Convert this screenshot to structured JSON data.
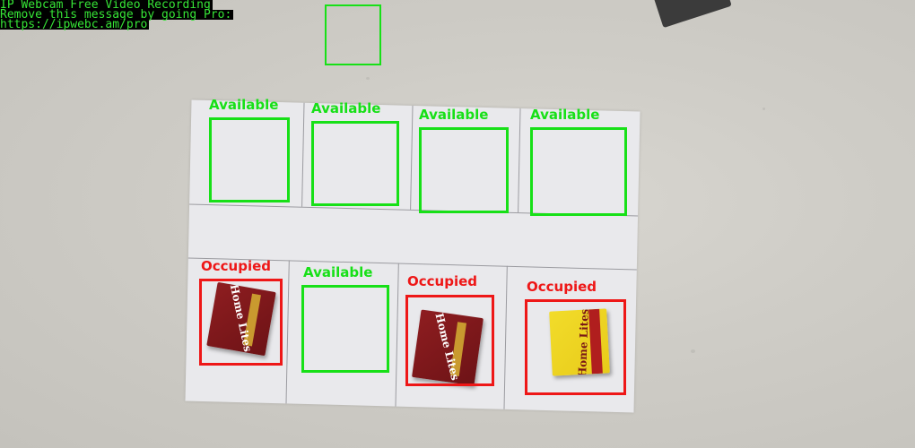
{
  "watermark": {
    "line1": "IP Webcam Free Video Recording",
    "line2": "Remove this message by going Pro:",
    "line3": "https://ipwebc.am/pro"
  },
  "slots": [
    {
      "status": "Available",
      "occupied": false
    },
    {
      "status": "Available",
      "occupied": false
    },
    {
      "status": "Available",
      "occupied": false
    },
    {
      "status": "Available",
      "occupied": false
    },
    {
      "status": "Occupied",
      "occupied": true
    },
    {
      "status": "Available",
      "occupied": false
    },
    {
      "status": "Occupied",
      "occupied": true
    },
    {
      "status": "Occupied",
      "occupied": true
    }
  ],
  "products": [
    {
      "brand": "Home Lites",
      "color": "red"
    },
    {
      "brand": "Home Lites",
      "color": "red"
    },
    {
      "brand": "Home Lites",
      "color": "yellow"
    }
  ],
  "colors": {
    "available": "#17e017",
    "occupied": "#ee1717",
    "watermark_text": "#36e436"
  }
}
